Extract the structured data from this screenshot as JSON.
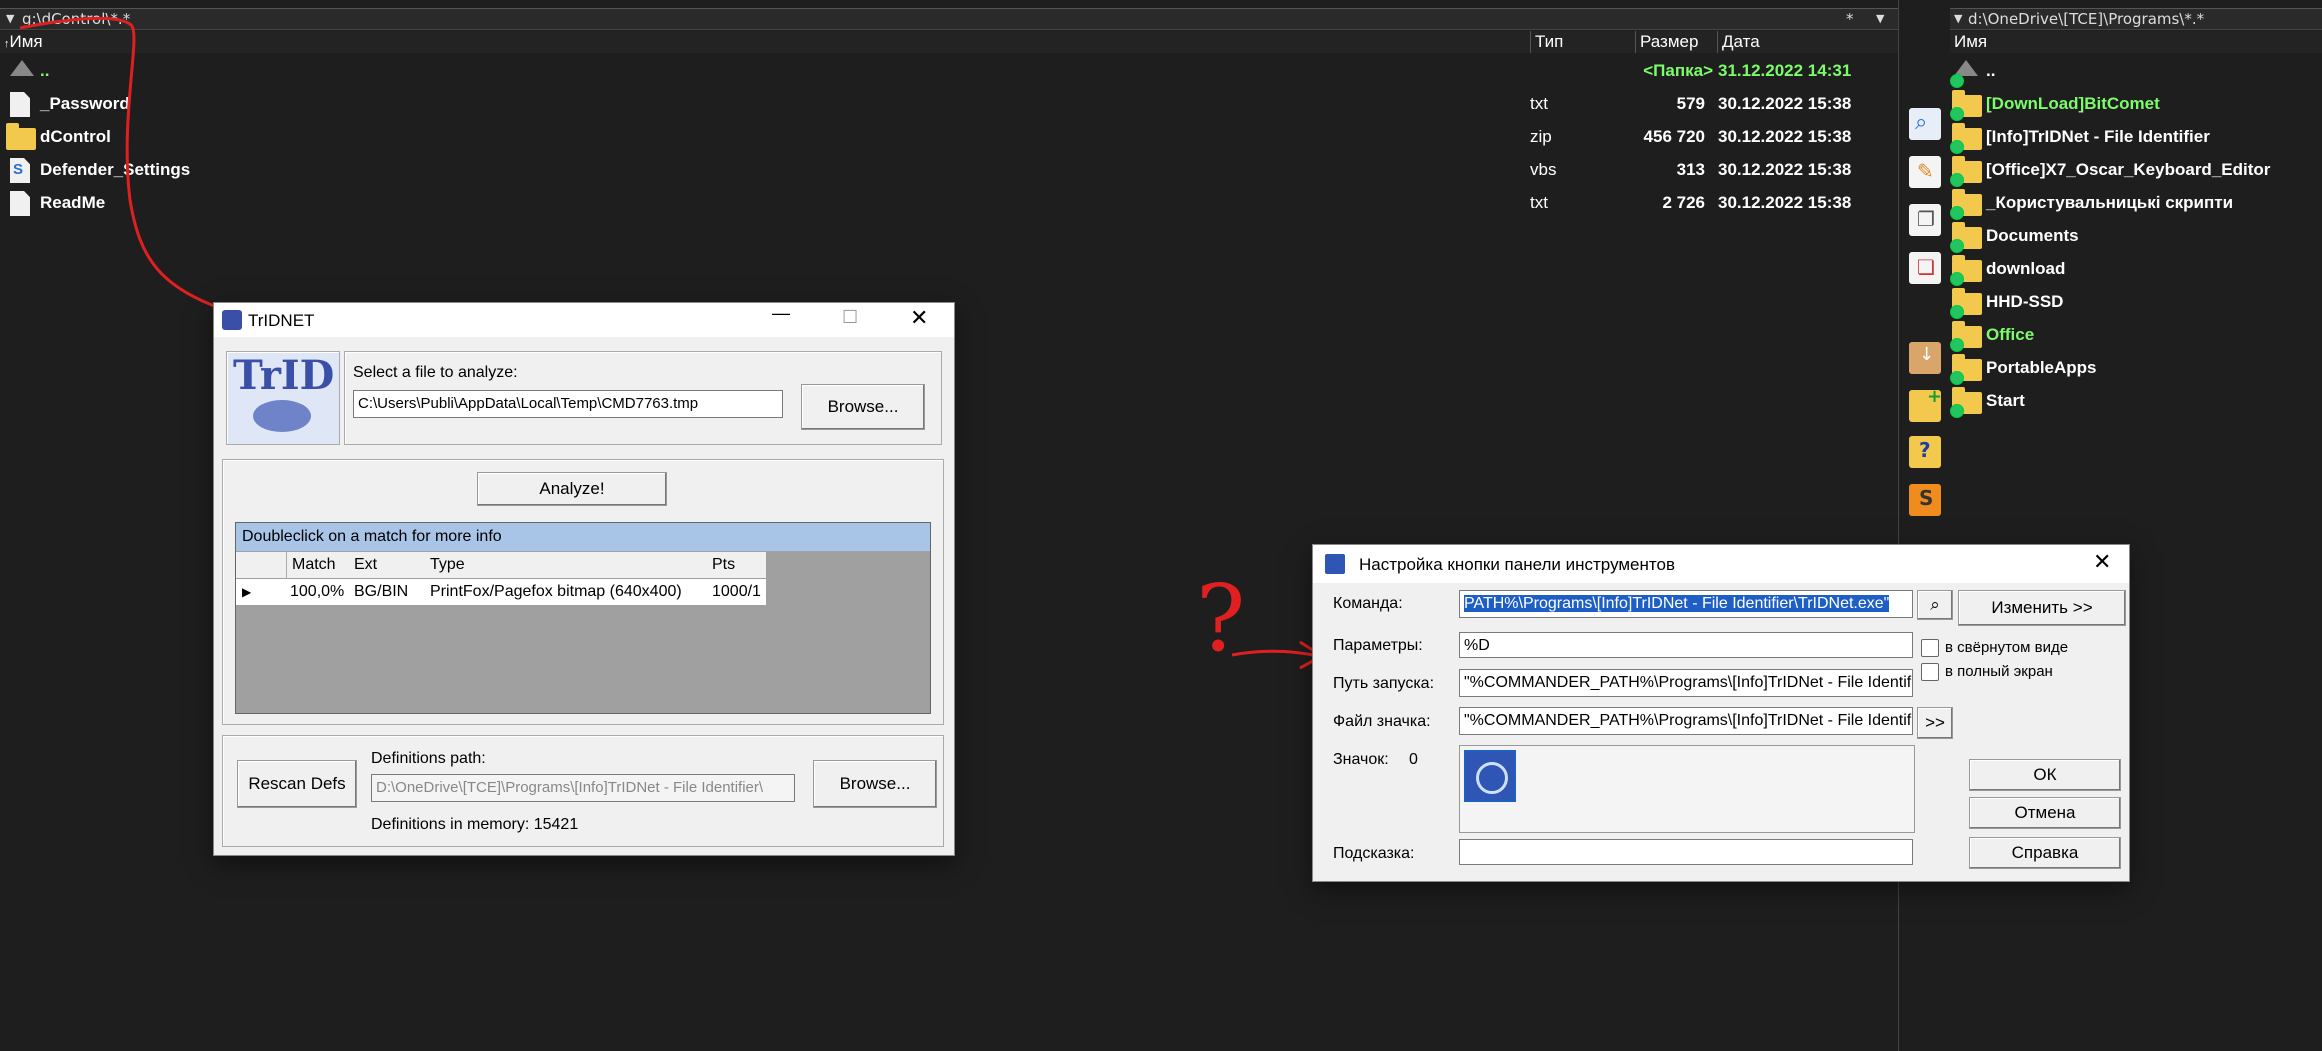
{
  "left_panel": {
    "path": "g:\\dControl\\*.*",
    "filter": "*",
    "columns": {
      "name": "Имя",
      "type": "Тип",
      "size": "Размер",
      "date": "Дата"
    },
    "files": [
      {
        "name": "..",
        "type": "",
        "size": "<Папка>",
        "date": "31.12.2022 14:31",
        "icon": "up-icon"
      },
      {
        "name": "_Password",
        "type": "txt",
        "size": "579",
        "date": "30.12.2022 15:38",
        "icon": "text-file-icon"
      },
      {
        "name": "dControl",
        "type": "zip",
        "size": "456 720",
        "date": "30.12.2022 15:38",
        "icon": "zip-folder-icon"
      },
      {
        "name": "Defender_Settings",
        "type": "vbs",
        "size": "313",
        "date": "30.12.2022 15:38",
        "icon": "script-file-icon"
      },
      {
        "name": "ReadMe",
        "type": "txt",
        "size": "2 726",
        "date": "30.12.2022 15:38",
        "icon": "text-file-icon"
      }
    ]
  },
  "right_panel": {
    "path": "d:\\OneDrive\\[TCE]\\Programs\\*.*",
    "column": "Имя",
    "items": [
      {
        "name": "..",
        "color": "#ffffff"
      },
      {
        "name": "[DownLoad]BitComet",
        "color": "#7CFC6A"
      },
      {
        "name": "[Info]TrIDNet - File Identifier",
        "color": "#ffffff"
      },
      {
        "name": "[Office]X7_Oscar_Keyboard_Editor",
        "color": "#ffffff"
      },
      {
        "name": "_Користувальницькі скрипти",
        "color": "#ffffff"
      },
      {
        "name": "Documents",
        "color": "#ffffff"
      },
      {
        "name": "download",
        "color": "#ffffff"
      },
      {
        "name": "HHD-SSD",
        "color": "#ffffff"
      },
      {
        "name": "Office",
        "color": "#7CFC6A"
      },
      {
        "name": "PortableApps",
        "color": "#ffffff"
      },
      {
        "name": "Start",
        "color": "#ffffff"
      }
    ]
  },
  "trid": {
    "title": "TrIDNET",
    "logo_text": "TrID",
    "select_label": "Select a file to analyze:",
    "file_path": "C:\\Users\\Publi\\AppData\\Local\\Temp\\CMD7763.tmp",
    "browse": "Browse...",
    "analyze": "Analyze!",
    "results_header": "Doubleclick on a match for more info",
    "table_cols": [
      "Match",
      "Ext",
      "Type",
      "Pts"
    ],
    "results": [
      {
        "match": "100,0%",
        "ext": "BG/BIN",
        "type": "PrintFox/Pagefox bitmap (640x400)",
        "pts": "1000/1"
      }
    ],
    "rescan": "Rescan Defs",
    "defs_label": "Definitions path:",
    "defs_path": "D:\\OneDrive\\[TCE]\\Programs\\[Info]TrIDNet - File Identifier\\",
    "defs_browse": "Browse...",
    "defs_memory": "Definitions in memory: 15421"
  },
  "dialog": {
    "title": "Настройка кнопки панели инструментов",
    "command_label": "Команда:",
    "command_value": "PATH%\\Programs\\[Info]TrIDNet - File Identifier\\TrIDNet.exe\"",
    "change_button": "Изменить >>",
    "params_label": "Параметры:",
    "params_value": "%D",
    "minimized_label": "в свёрнутом виде",
    "fullscreen_label": "в полный экран",
    "startpath_label": "Путь запуска:",
    "startpath_value": "\"%COMMANDER_PATH%\\Programs\\[Info]TrIDNet - File Identifier\"",
    "iconfile_label": "Файл значка:",
    "iconfile_value": "\"%COMMANDER_PATH%\\Programs\\[Info]TrIDNet - File Identifier\\",
    "iconfile_button": ">>",
    "icon_label": "Значок:",
    "icon_index": "0",
    "tooltip_label": "Подсказка:",
    "tooltip_value": "",
    "ok": "ОК",
    "cancel": "Отмена",
    "help": "Справка"
  },
  "annotation": {
    "question_mark": "?",
    "color": "#e02020"
  }
}
